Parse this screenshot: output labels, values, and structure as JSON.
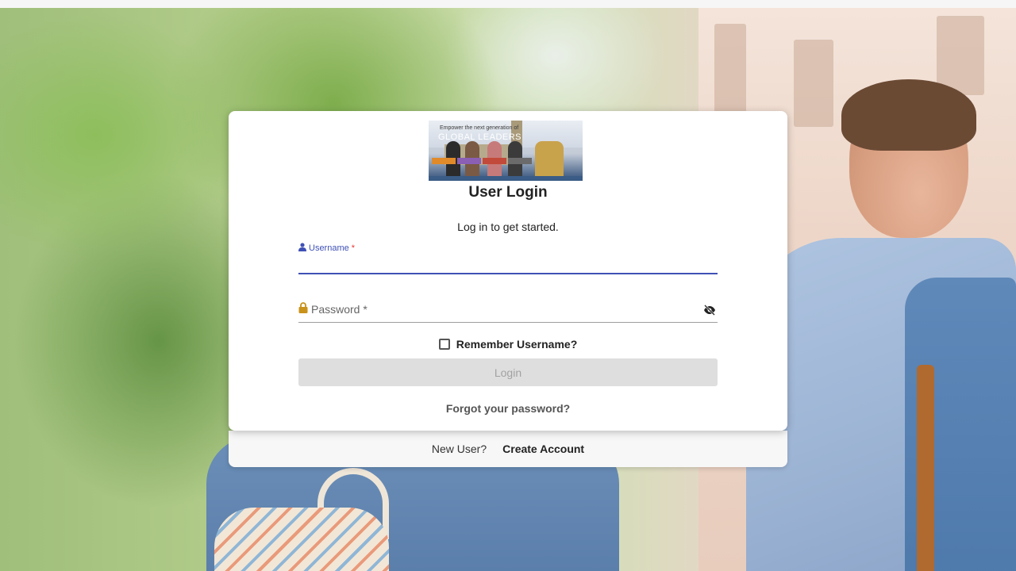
{
  "colors": {
    "accent": "#3f51b5",
    "required": "#e53935",
    "icon_gold": "#c8921b",
    "disabled_bg": "#dedede",
    "disabled_text": "#a2a2a2"
  },
  "banner": {
    "tagline": "Empower the next generation of",
    "headline": "GLOBAL LEADERS"
  },
  "login": {
    "title": "User Login",
    "subtitle": "Log in to get started.",
    "username": {
      "label": "Username",
      "required_mark": "*",
      "value": "",
      "icon": "user-icon"
    },
    "password": {
      "label": "Password *",
      "value": "",
      "icon": "lock-icon",
      "toggle_icon": "eye-off-icon"
    },
    "remember_label": "Remember Username?",
    "remember_checked": false,
    "login_button": "Login",
    "forgot_link": "Forgot your password?"
  },
  "footer": {
    "new_user": "New User?",
    "create_account": "Create Account"
  }
}
